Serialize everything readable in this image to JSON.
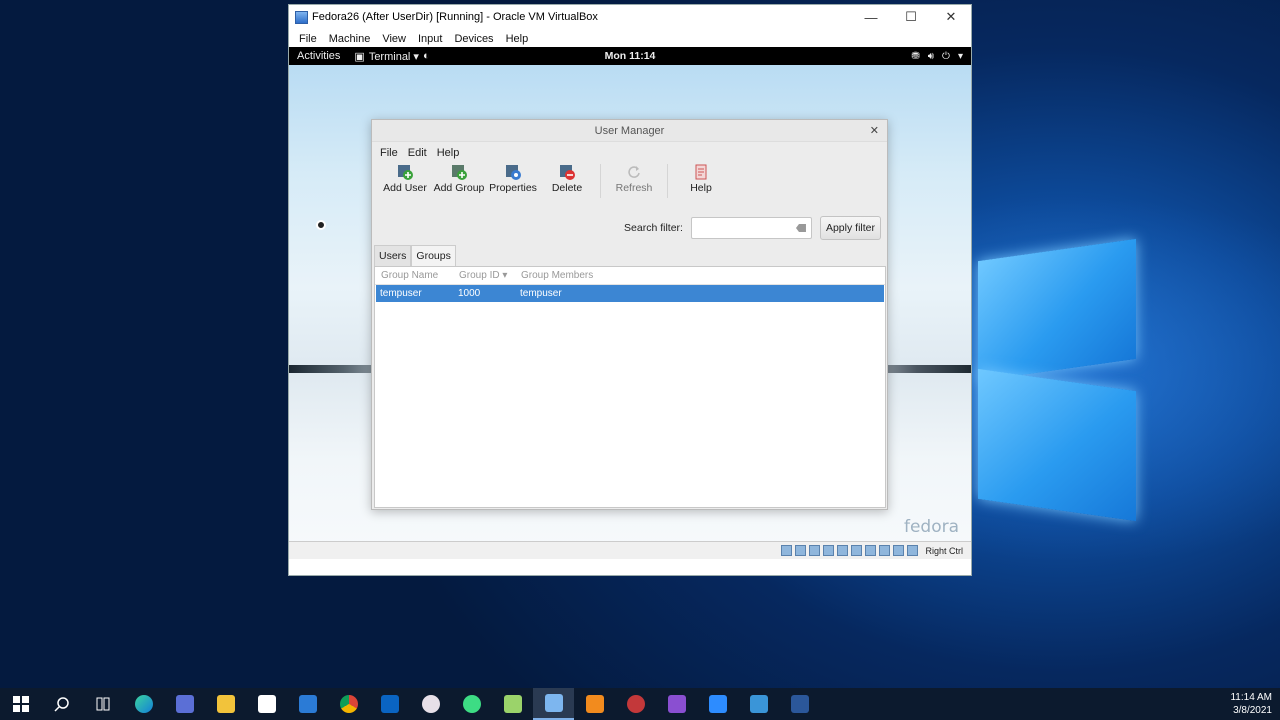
{
  "vbox": {
    "title": "Fedora26 (After UserDir) [Running] - Oracle VM VirtualBox",
    "menu": [
      "File",
      "Machine",
      "View",
      "Input",
      "Devices",
      "Help"
    ],
    "status_right": "Right Ctrl"
  },
  "gnome": {
    "activities": "Activities",
    "app": "Terminal ▾",
    "clock": "Mon 11:14",
    "watermark": "fedora"
  },
  "um": {
    "title": "User Manager",
    "menu": [
      "File",
      "Edit",
      "Help"
    ],
    "toolbar": {
      "add_user": "Add User",
      "add_group": "Add Group",
      "properties": "Properties",
      "delete": "Delete",
      "refresh": "Refresh",
      "help": "Help"
    },
    "search_label": "Search filter:",
    "apply_filter": "Apply filter",
    "tabs": [
      "Users",
      "Groups"
    ],
    "active_tab": "Groups",
    "columns": [
      "Group Name",
      "Group ID ▾",
      "Group Members"
    ],
    "rows": [
      {
        "name": "tempuser",
        "id": "1000",
        "members": "tempuser"
      }
    ]
  },
  "taskbar": {
    "time": "11:14 AM",
    "date": "3/8/2021",
    "apps": [
      "start-icon",
      "search-icon",
      "task-view-icon",
      "edge-icon",
      "network-app-icon",
      "file-explorer-icon",
      "store-icon",
      "mail-icon",
      "chrome-icon",
      "outlook-icon",
      "app-icon",
      "android-studio-icon",
      "app-icon-2",
      "virtualbox-icon",
      "sublime-icon",
      "app-icon-3",
      "visual-studio-icon",
      "zoom-icon",
      "photos-icon",
      "word-icon"
    ]
  },
  "colors": {
    "selection": "#3c86d3",
    "desktop": "#06285f"
  }
}
